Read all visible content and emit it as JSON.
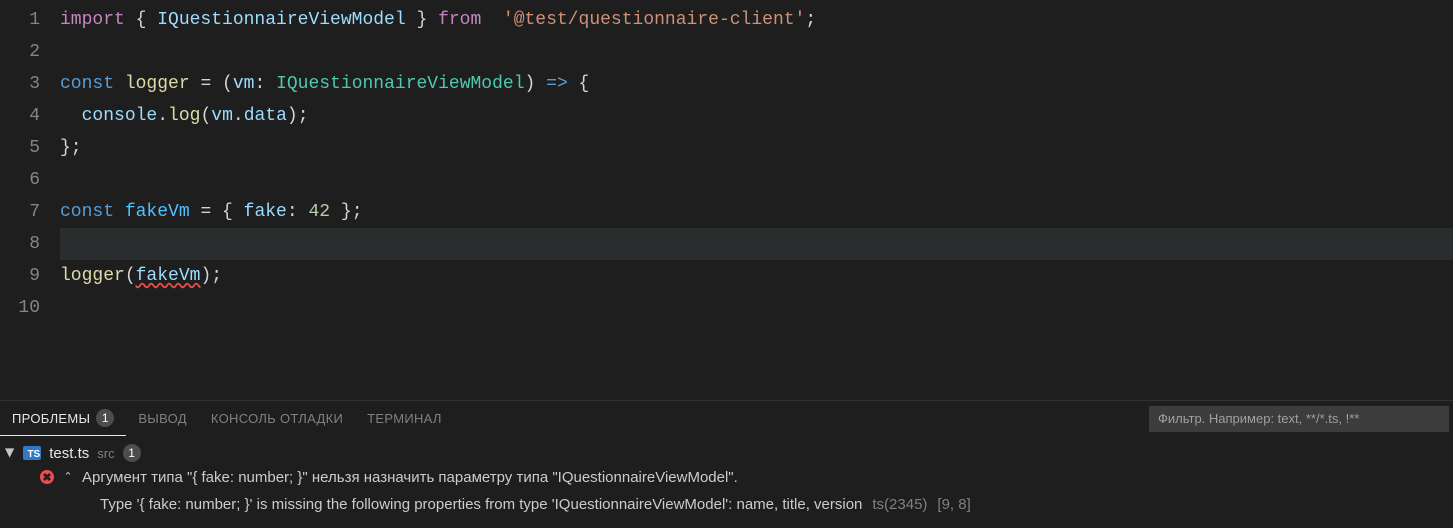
{
  "editor": {
    "lines": [
      {
        "n": "1",
        "tokens": [
          {
            "c": "c-import",
            "t": "import"
          },
          {
            "c": "c-plain",
            "t": " { "
          },
          {
            "c": "c-id",
            "t": "IQuestionnaireViewModel"
          },
          {
            "c": "c-plain",
            "t": " } "
          },
          {
            "c": "c-import",
            "t": "from"
          },
          {
            "c": "c-plain",
            "t": "  "
          },
          {
            "c": "c-string",
            "t": "'@test/questionnaire-client'"
          },
          {
            "c": "c-plain",
            "t": ";"
          }
        ]
      },
      {
        "n": "2",
        "tokens": []
      },
      {
        "n": "3",
        "tokens": [
          {
            "c": "c-keyword",
            "t": "const"
          },
          {
            "c": "c-plain",
            "t": " "
          },
          {
            "c": "c-func",
            "t": "logger"
          },
          {
            "c": "c-plain",
            "t": " = ("
          },
          {
            "c": "c-id",
            "t": "vm"
          },
          {
            "c": "c-plain",
            "t": ": "
          },
          {
            "c": "c-type",
            "t": "IQuestionnaireViewModel"
          },
          {
            "c": "c-plain",
            "t": ") "
          },
          {
            "c": "c-keyword",
            "t": "=>"
          },
          {
            "c": "c-plain",
            "t": " {"
          }
        ]
      },
      {
        "n": "4",
        "tokens": [
          {
            "c": "c-plain",
            "t": "  "
          },
          {
            "c": "c-obj",
            "t": "console"
          },
          {
            "c": "c-plain",
            "t": "."
          },
          {
            "c": "c-func",
            "t": "log"
          },
          {
            "c": "c-plain",
            "t": "("
          },
          {
            "c": "c-id",
            "t": "vm"
          },
          {
            "c": "c-plain",
            "t": "."
          },
          {
            "c": "c-id",
            "t": "data"
          },
          {
            "c": "c-plain",
            "t": ");"
          }
        ]
      },
      {
        "n": "5",
        "tokens": [
          {
            "c": "c-plain",
            "t": "};"
          }
        ]
      },
      {
        "n": "6",
        "tokens": []
      },
      {
        "n": "7",
        "tokens": [
          {
            "c": "c-keyword",
            "t": "const"
          },
          {
            "c": "c-plain",
            "t": " "
          },
          {
            "c": "c-const2",
            "t": "fakeVm"
          },
          {
            "c": "c-plain",
            "t": " = { "
          },
          {
            "c": "c-id",
            "t": "fake"
          },
          {
            "c": "c-plain",
            "t": ": "
          },
          {
            "c": "c-num",
            "t": "42"
          },
          {
            "c": "c-plain",
            "t": " };"
          }
        ]
      },
      {
        "n": "8",
        "tokens": [],
        "current": true
      },
      {
        "n": "9",
        "tokens": [
          {
            "c": "c-func",
            "t": "logger"
          },
          {
            "c": "c-plain",
            "t": "("
          },
          {
            "c": "c-id err-underline",
            "t": "fakeVm"
          },
          {
            "c": "c-plain",
            "t": ");"
          }
        ]
      },
      {
        "n": "10",
        "tokens": []
      }
    ]
  },
  "panel": {
    "tabs": {
      "problems": "Проблемы",
      "problems_count": "1",
      "output": "Вывод",
      "debug": "Консоль отладки",
      "terminal": "Терминал"
    },
    "filter_placeholder": "Фильтр. Например: text, **/*.ts, !**",
    "file": {
      "icon": "TS",
      "name": "test.ts",
      "path": "src",
      "count": "1"
    },
    "problem": {
      "text": "Аргумент типа \"{ fake: number; }\" нельзя назначить параметру типа \"IQuestionnaireViewModel\".",
      "sub": "Type '{ fake: number; }' is missing the following properties from type 'IQuestionnaireViewModel': name, title, version",
      "code": "ts(2345)",
      "loc": "[9, 8]"
    }
  }
}
